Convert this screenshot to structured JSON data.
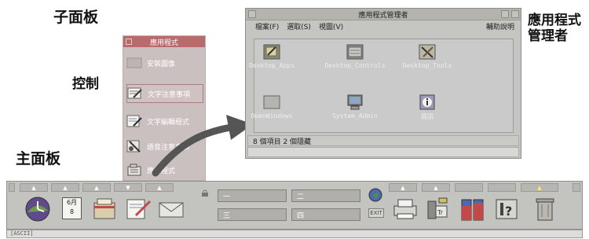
{
  "callouts": {
    "subpanel": "子面板",
    "control": "控制",
    "main_panel": "主面板",
    "app_manager_line1": "應用程式",
    "app_manager_line2": "管理者"
  },
  "subpanel": {
    "title": "應用程式",
    "items": [
      {
        "label": "安裝圖像",
        "icon": "install-icon-icon"
      },
      {
        "label": "文字注意事項",
        "icon": "text-note-icon"
      },
      {
        "label": "文字編輯程式",
        "icon": "text-editor-icon"
      },
      {
        "label": "語音注意事項",
        "icon": "voice-note-icon"
      },
      {
        "label": "應用程式",
        "icon": "app-manager-icon"
      }
    ]
  },
  "app_manager": {
    "title": "應用程式管理者",
    "menu": {
      "file": "檔案(F)",
      "select": "選取(S)",
      "view": "視圖(V)",
      "help": "輔助說明"
    },
    "icons": [
      {
        "label": "Desktop_Apps",
        "icon": "folder-notepad-icon"
      },
      {
        "label": "Desktop_Controls",
        "icon": "folder-controls-icon"
      },
      {
        "label": "Desktop_Tools",
        "icon": "folder-tools-icon"
      },
      {
        "label": "OpenWindows",
        "icon": "folder-icon"
      },
      {
        "label": "System_Admin",
        "icon": "monitor-icon"
      },
      {
        "label": "資訊",
        "icon": "info-icon"
      }
    ],
    "status": "8 個項目 2 個隱藏"
  },
  "front_panel": {
    "workspaces": [
      "一",
      "二",
      "三",
      "四"
    ],
    "exit": "EXIT",
    "calendar_month": "6月",
    "calendar_day": "8",
    "bottom_text": "[ASCII]",
    "colors": {
      "panel": "#c3c3c0",
      "accent_red": "#c44848",
      "accent_blue": "#4a6ab0"
    }
  }
}
